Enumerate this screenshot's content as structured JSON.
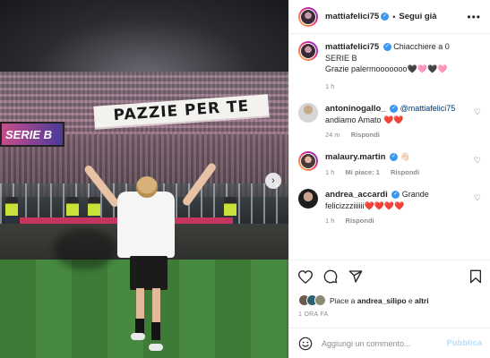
{
  "post": {
    "banner_text": "PAZZIE PER TE",
    "screen_text": "SERIE B"
  },
  "header": {
    "username": "mattiafelici75",
    "separator": "•",
    "follow_label": "Segui già",
    "more_icon": "more-horizontal-icon"
  },
  "caption": {
    "username": "mattiafelici75",
    "line1": "Chiacchiere a 0",
    "line2": "SERIE B",
    "line3": "Grazie palermooooooo🖤🩷🖤🩷",
    "time": "1 h"
  },
  "comments": [
    {
      "username": "antoninogallo_",
      "mention": "@mattiafelici75",
      "text": "andiamo Amato ❤️❤️",
      "time": "24 m",
      "reply_label": "Rispondi"
    },
    {
      "username": "malaury.martin",
      "text": "👋🏻",
      "time": "1 h",
      "likes_label": "Mi piace: 1",
      "reply_label": "Rispondi"
    },
    {
      "username": "andrea_accardi",
      "text_line1": "Grande",
      "text_line2": "felicizzziiiiii❤️❤️❤️❤️",
      "time": "1 h",
      "reply_label": "Rispondi"
    }
  ],
  "likes": {
    "prefix": "Piace a ",
    "user": "andrea_silipo",
    "suffix": " e ",
    "others": "altri"
  },
  "timestamp": "1 ORA FA",
  "add_comment": {
    "placeholder": "Aggiungi un commento...",
    "publish_label": "Pubblica"
  },
  "colors": {
    "verified": "#3897f0",
    "link": "#00376b",
    "muted": "#8e8e8e",
    "publish_disabled": "#b2dffc"
  }
}
